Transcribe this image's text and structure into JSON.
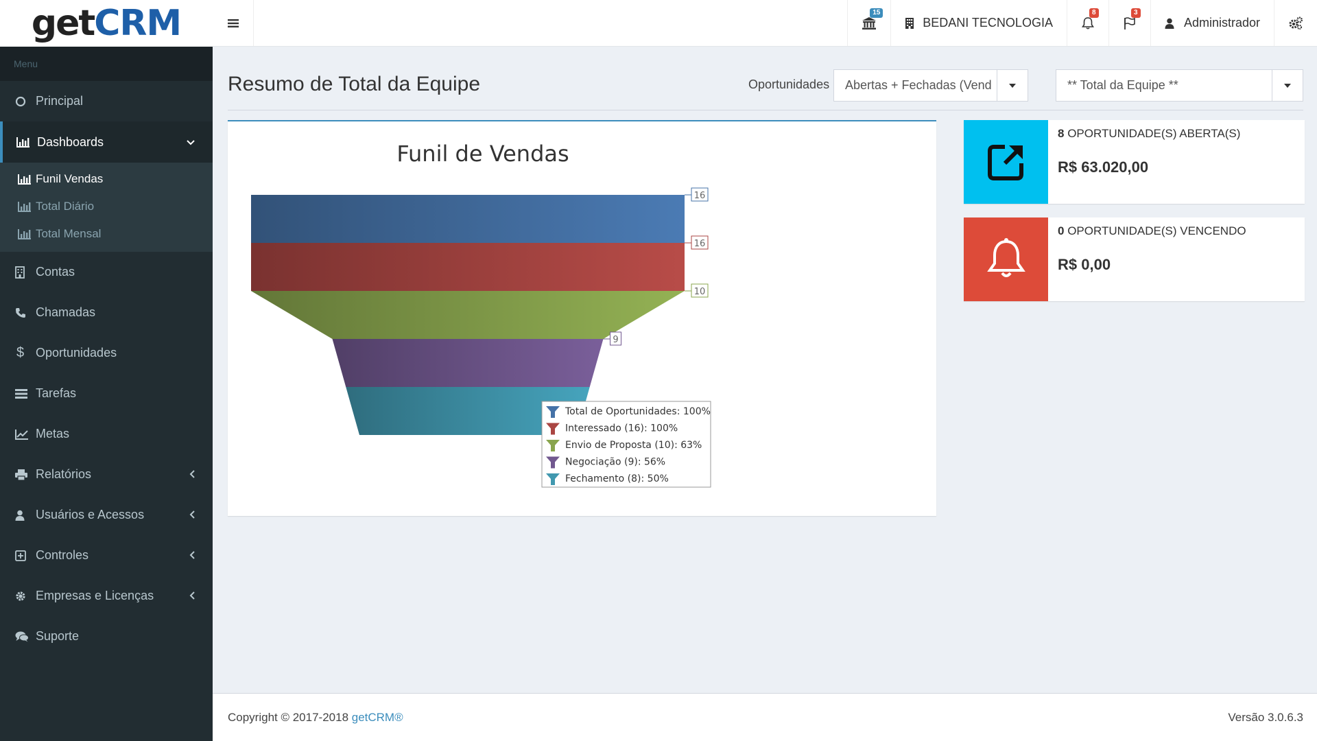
{
  "brand": {
    "part1": "get",
    "part2": "CRM"
  },
  "navbar": {
    "bank_badge": "15",
    "company": "BEDANI TECNOLOGIA",
    "bell_badge": "8",
    "flag_badge": "3",
    "user": "Administrador"
  },
  "sidebar": {
    "header": "Menu",
    "principal": "Principal",
    "dashboards": "Dashboards",
    "sub": [
      "Funil Vendas",
      "Total Diário",
      "Total Mensal"
    ],
    "contas": "Contas",
    "chamadas": "Chamadas",
    "oportunidades": "Oportunidades",
    "tarefas": "Tarefas",
    "metas": "Metas",
    "relatorios": "Relatórios",
    "usuarios": "Usuários e Acessos",
    "controles": "Controles",
    "empresas": "Empresas e Licenças",
    "suporte": "Suporte"
  },
  "page": {
    "title": "Resumo de Total da Equipe",
    "filter_label": "Oportunidades",
    "filter_value": "Abertas + Fechadas (Vend",
    "team_value": "** Total da Equipe **"
  },
  "chart_data": {
    "type": "funnel",
    "title": "Funil de Vendas",
    "categories": [
      "Total de Oportunidades",
      "Interessado",
      "Envio de Proposta",
      "Negociação",
      "Fechamento"
    ],
    "values": [
      16,
      16,
      10,
      9,
      8
    ],
    "data_labels": [
      "16",
      "16",
      "10",
      "9",
      ""
    ],
    "legend": [
      "Total de Oportunidades: 100%",
      "Interessado (16): 100%",
      "Envio de Proposta (10): 63%",
      "Negociação (9): 56%",
      "Fechamento (8): 50%"
    ],
    "colors": [
      "#4572a7",
      "#aa4643",
      "#89a54e",
      "#71588f",
      "#4198af"
    ]
  },
  "info": {
    "open_count": "8",
    "open_label": " OPORTUNIDADE(S) ABERTA(S)",
    "open_value": "R$ 63.020,00",
    "open_color": "#00c0ef",
    "due_count": "0",
    "due_label": " OPORTUNIDADE(S) VENCENDO",
    "due_value": "R$ 0,00",
    "due_color": "#dd4b39"
  },
  "footer": {
    "copyright": "Copyright © 2017-2018 ",
    "link": "getCRM®",
    "version": "Versão 3.0.6.3"
  }
}
